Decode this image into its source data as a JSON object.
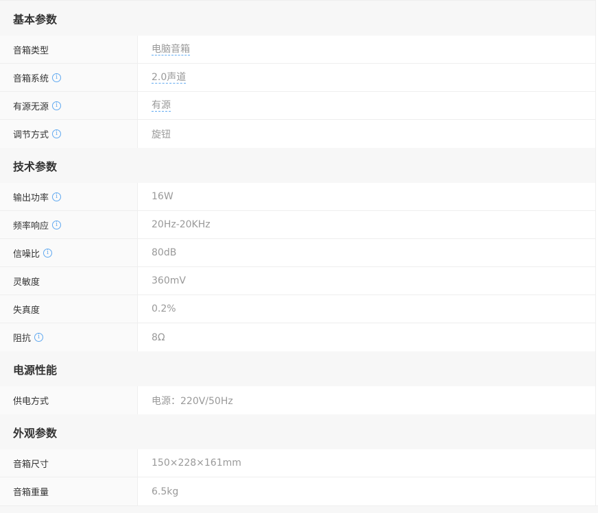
{
  "sections": [
    {
      "title": "基本参数",
      "rows": [
        {
          "name": "音箱类型",
          "value": "电脑音箱",
          "help": false,
          "link": true
        },
        {
          "name": "音箱系统",
          "value": "2.0声道",
          "help": true,
          "link": true
        },
        {
          "name": "有源无源",
          "value": "有源",
          "help": true,
          "link": true
        },
        {
          "name": "调节方式",
          "value": "旋钮",
          "help": true,
          "link": false
        }
      ]
    },
    {
      "title": "技术参数",
      "rows": [
        {
          "name": "输出功率",
          "value": "16W",
          "help": true,
          "link": false
        },
        {
          "name": "频率响应",
          "value": "20Hz-20KHz",
          "help": true,
          "link": false
        },
        {
          "name": "信噪比",
          "value": "80dB",
          "help": true,
          "link": false
        },
        {
          "name": "灵敏度",
          "value": "360mV",
          "help": false,
          "link": false
        },
        {
          "name": "失真度",
          "value": "0.2%",
          "help": false,
          "link": false
        },
        {
          "name": "阻抗",
          "value": "8Ω",
          "help": true,
          "link": false
        }
      ]
    },
    {
      "title": "电源性能",
      "rows": [
        {
          "name": "供电方式",
          "value": "电源：220V/50Hz",
          "help": false,
          "link": false
        }
      ]
    },
    {
      "title": "外观参数",
      "rows": [
        {
          "name": "音箱尺寸",
          "value": "150×228×161mm",
          "help": false,
          "link": false
        },
        {
          "name": "音箱重量",
          "value": "6.5kg",
          "help": false,
          "link": false
        }
      ]
    }
  ],
  "icons": {
    "help": "info-icon",
    "help_glyph": "i"
  },
  "colors": {
    "accent": "#5fa8f0",
    "section_bg": "#f7f7f7",
    "label_bg": "#fafafa",
    "value_text": "#999999",
    "label_text": "#333333"
  }
}
